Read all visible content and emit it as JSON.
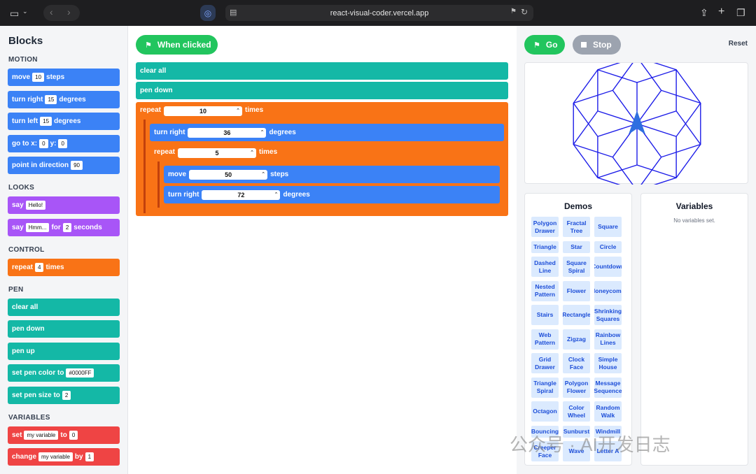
{
  "browser": {
    "url": "react-visual-coder.vercel.app"
  },
  "sidebar": {
    "title": "Blocks",
    "motion": {
      "heading": "MOTION",
      "move": {
        "a": "move",
        "v": "10",
        "b": "steps"
      },
      "turn_right": {
        "a": "turn right",
        "v": "15",
        "b": "degrees"
      },
      "turn_left": {
        "a": "turn left",
        "v": "15",
        "b": "degrees"
      },
      "goto": {
        "a": "go to x:",
        "x": "0",
        "ylab": "y:",
        "y": "0"
      },
      "point": {
        "a": "point in direction",
        "v": "90"
      }
    },
    "looks": {
      "heading": "LOOKS",
      "say": {
        "a": "say",
        "v": "Hello!"
      },
      "sayfor": {
        "a": "say",
        "v": "Hmm...",
        "b": "for",
        "n": "2",
        "c": "seconds"
      }
    },
    "control": {
      "heading": "CONTROL",
      "repeat": {
        "a": "repeat",
        "v": "4",
        "b": "times"
      }
    },
    "pen": {
      "heading": "PEN",
      "clear": "clear all",
      "down": "pen down",
      "up": "pen up",
      "color": {
        "a": "set pen color to",
        "v": "#0000FF"
      },
      "size": {
        "a": "set pen size to",
        "v": "2"
      }
    },
    "variables": {
      "heading": "VARIABLES",
      "set": {
        "a": "set",
        "v": "my variable",
        "b": "to",
        "n": "0"
      },
      "change": {
        "a": "change",
        "v": "my variable",
        "b": "by",
        "n": "1"
      }
    }
  },
  "workspace": {
    "when_clicked": "When clicked",
    "clear": "clear all",
    "pendown": "pen down",
    "repeat1": {
      "a": "repeat",
      "v": "10",
      "b": "times"
    },
    "turn1": {
      "a": "turn right",
      "v": "36",
      "b": "degrees"
    },
    "repeat2": {
      "a": "repeat",
      "v": "5",
      "b": "times"
    },
    "move": {
      "a": "move",
      "v": "50",
      "b": "steps"
    },
    "turn2": {
      "a": "turn right",
      "v": "72",
      "b": "degrees"
    }
  },
  "controls": {
    "go": "Go",
    "stop": "Stop",
    "reset": "Reset"
  },
  "demos": {
    "title": "Demos",
    "items": [
      "Polygon Drawer",
      "Fractal Tree",
      "Square",
      "Triangle",
      "Star",
      "Circle",
      "Dashed Line",
      "Square Spiral",
      "Countdown",
      "Nested Pattern",
      "Flower",
      "Honeycomb",
      "Stairs",
      "Rectangle",
      "Shrinking Squares",
      "Web Pattern",
      "Zigzag",
      "Rainbow Lines",
      "Grid Drawer",
      "Clock Face",
      "Simple House",
      "Triangle Spiral",
      "Polygon Flower",
      "Message Sequence",
      "Octagon",
      "Color Wheel",
      "Random Walk",
      "Bouncing",
      "Sunburst",
      "Windmill",
      "Creeper Face",
      "Wave",
      "Letter A"
    ]
  },
  "variables": {
    "title": "Variables",
    "empty": "No variables set."
  },
  "watermark": "公众号 · AI开发日志",
  "colors": {
    "motion": "#3b82f6",
    "looks": "#a855f7",
    "control": "#f97316",
    "pen": "#14b8a6",
    "variables": "#ef4444",
    "go": "#22c55e",
    "stroke": "#1d1de8"
  }
}
